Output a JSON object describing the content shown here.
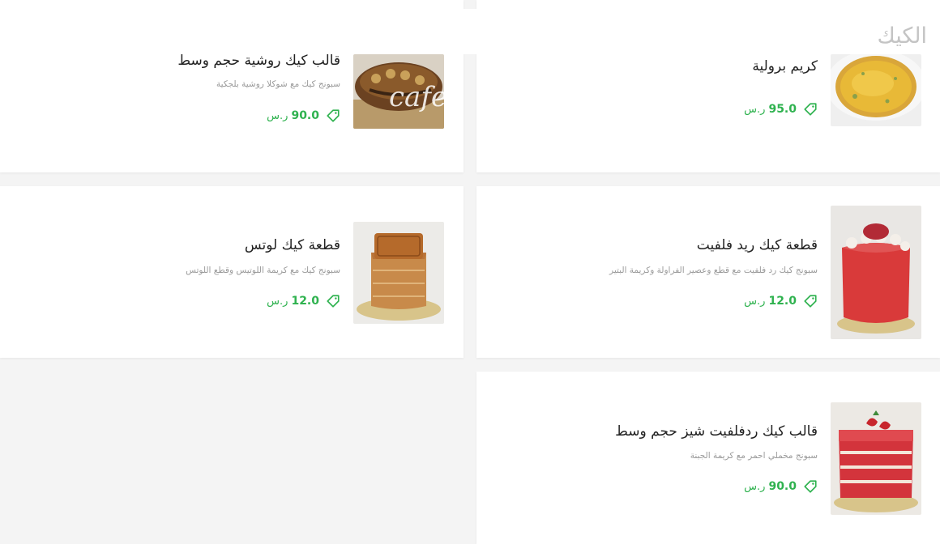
{
  "section": {
    "title": "الكيك"
  },
  "brand": {
    "accent": "#2fb24f",
    "watermark": "cafe"
  },
  "items": [
    {
      "title": "كريم برولية",
      "description": "",
      "price": "95.0",
      "currency": "ر.س",
      "image": "creme-brulee"
    },
    {
      "title": "قالب كيك روشية حجم وسط",
      "description": "سبونج كيك مع شوكلا روشية بلجكية",
      "price": "90.0",
      "currency": "ر.س",
      "image": "rocher-cake"
    },
    {
      "title": "قطعة كيك ريد فلفيت",
      "description": "سبونج كيك رد فلفيت مع قطع وعصير الفراولة وكريمة البتير",
      "price": "12.0",
      "currency": "ر.س",
      "image": "red-velvet-slice"
    },
    {
      "title": "قطعة كيك لوتس",
      "description": "سبونج كيك مع كريمة اللوتيس وقطع اللوتس",
      "price": "12.0",
      "currency": "ر.س",
      "image": "lotus-slice"
    },
    {
      "title": "قالب كيك ردفلفيت شيز حجم وسط",
      "description": "سبونج مخملي احمر مع كريمة الجبنة",
      "price": "90.0",
      "currency": "ر.س",
      "image": "red-velvet-cheese-cake"
    }
  ]
}
